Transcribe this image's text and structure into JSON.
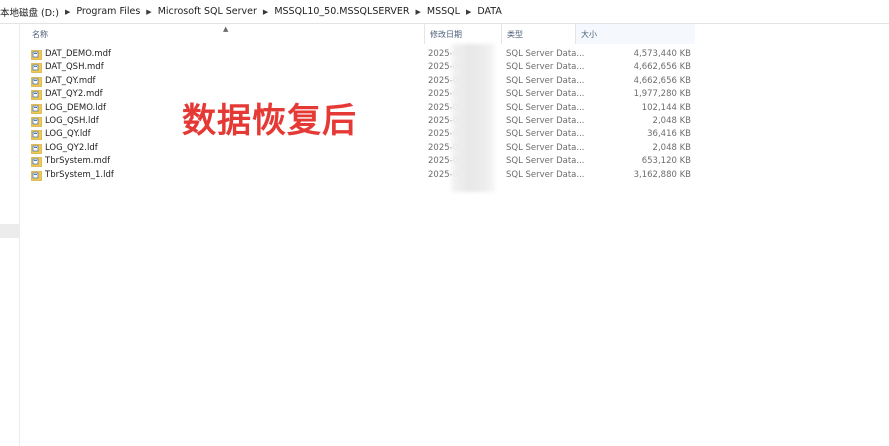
{
  "breadcrumb": [
    "本地磁盘 (D:)",
    "Program Files",
    "Microsoft SQL Server",
    "MSSQL10_50.MSSQLSERVER",
    "MSSQL",
    "DATA"
  ],
  "columns": {
    "name": "名称",
    "date": "修改日期",
    "type": "类型",
    "size": "大小"
  },
  "files": [
    {
      "name": "DAT_DEMO.mdf",
      "date": "2025-0",
      "type": "SQL Server Data...",
      "size": "4,573,440 KB"
    },
    {
      "name": "DAT_QSH.mdf",
      "date": "2025-0",
      "type": "SQL Server Data...",
      "size": "4,662,656 KB"
    },
    {
      "name": "DAT_QY.mdf",
      "date": "2025-0",
      "type": "SQL Server Data...",
      "size": "4,662,656 KB"
    },
    {
      "name": "DAT_QY2.mdf",
      "date": "2025-0",
      "type": "SQL Server Data...",
      "size": "1,977,280 KB"
    },
    {
      "name": "LOG_DEMO.ldf",
      "date": "2025-0",
      "type": "SQL Server Data...",
      "size": "102,144 KB"
    },
    {
      "name": "LOG_QSH.ldf",
      "date": "2025-0",
      "type": "SQL Server Data...",
      "size": "2,048 KB"
    },
    {
      "name": "LOG_QY.ldf",
      "date": "2025-0",
      "type": "SQL Server Data...",
      "size": "36,416 KB"
    },
    {
      "name": "LOG_QY2.ldf",
      "date": "2025-0",
      "type": "SQL Server Data...",
      "size": "2,048 KB"
    },
    {
      "name": "TbrSystem.mdf",
      "date": "2025-0",
      "type": "SQL Server Data...",
      "size": "653,120 KB"
    },
    {
      "name": "TbrSystem_1.ldf",
      "date": "2025-0",
      "type": "SQL Server Data...",
      "size": "3,162,880 KB"
    }
  ],
  "file_icon": "sql-database-file-icon",
  "overlay_caption": "数据恢复后",
  "colors": {
    "caption": "#e53935",
    "header_text": "#4c607a",
    "icon_yellow": "#f2c94c",
    "icon_blue": "#4a79c4"
  }
}
